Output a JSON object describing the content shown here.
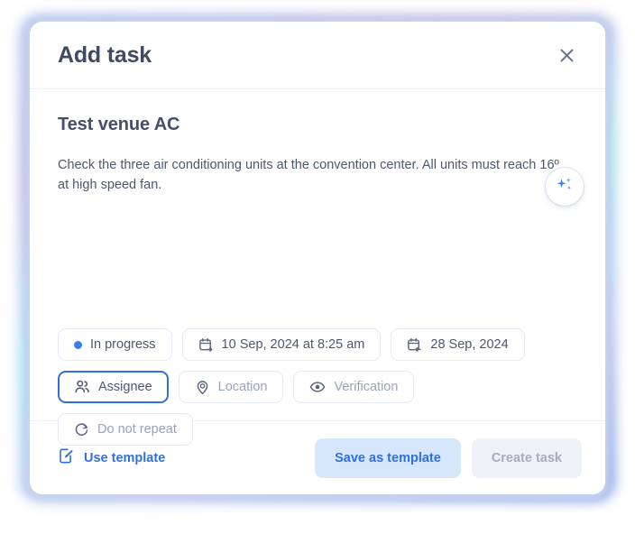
{
  "modal": {
    "title": "Add task",
    "close_icon": "close-icon"
  },
  "task": {
    "title": "Test venue AC",
    "description": "Check the three air conditioning units at the convention center. All units must reach 16º at high speed fan."
  },
  "ai_button": {
    "icon": "sparkles-icon",
    "label": ""
  },
  "chips": {
    "row1": [
      {
        "label": "In progress",
        "icon": "status-dot-icon",
        "state": "filled"
      },
      {
        "label": "10 Sep, 2024 at 8:25 am",
        "icon": "calendar-start-icon",
        "state": "filled"
      },
      {
        "label": "28 Sep, 2024",
        "icon": "calendar-due-icon",
        "state": "filled"
      }
    ],
    "row2": [
      {
        "label": "Assignee",
        "icon": "users-icon",
        "state": "focused"
      },
      {
        "label": "Location",
        "icon": "map-pin-icon",
        "state": "placeholder"
      },
      {
        "label": "Verification",
        "icon": "eye-icon",
        "state": "placeholder"
      }
    ],
    "row3": [
      {
        "label": "Do not repeat",
        "icon": "repeat-icon",
        "state": "placeholder"
      }
    ]
  },
  "footer": {
    "use_template_label": "Use template",
    "use_template_icon": "document-edit-icon",
    "save_as_template_label": "Save as template",
    "create_task_label": "Create task"
  },
  "colors": {
    "accent_blue": "#2f6fe4",
    "status_dot": "#3b7ef0",
    "secondary_button_bg": "#d7e7fb",
    "disabled_button_bg": "#eef1f7",
    "title_text": "#3f4a63",
    "body_text": "#4d5770",
    "placeholder_text": "#9aa2bb",
    "chip_border": "#e5e9f2",
    "divider": "#eceff5"
  }
}
